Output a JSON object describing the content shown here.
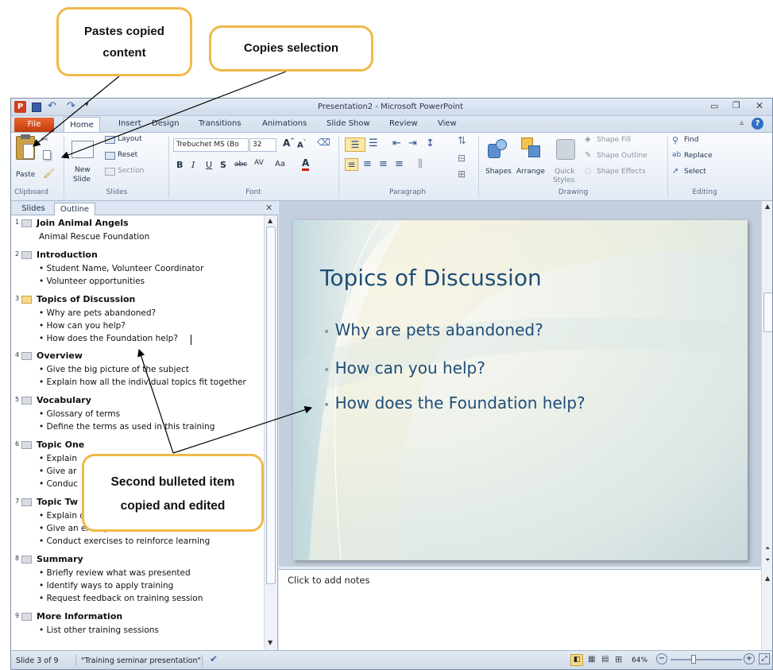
{
  "window": {
    "title": "Presentation2 - Microsoft PowerPoint",
    "tabs": [
      "File",
      "Home",
      "Insert",
      "Design",
      "Transitions",
      "Animations",
      "Slide Show",
      "Review",
      "View"
    ]
  },
  "ribbon": {
    "clipboard": {
      "paste": "Paste",
      "label": "Clipboard"
    },
    "slides": {
      "new_slide": "New",
      "new_slide2": "Slide",
      "layout": "Layout",
      "reset": "Reset",
      "section": "Section",
      "label": "Slides"
    },
    "font": {
      "name": "Trebuchet MS (Bo",
      "size": "32",
      "label": "Font"
    },
    "paragraph": {
      "label": "Paragraph"
    },
    "drawing": {
      "shapes": "Shapes",
      "arrange": "Arrange",
      "quick": "Quick",
      "styles": "Styles",
      "fill": "Shape Fill",
      "outline": "Shape Outline",
      "effects": "Shape Effects",
      "label": "Drawing"
    },
    "editing": {
      "find": "Find",
      "replace": "Replace",
      "select": "Select",
      "label": "Editing"
    }
  },
  "pane": {
    "tab_slides": "Slides",
    "tab_outline": "Outline"
  },
  "outline": [
    {
      "num": "1",
      "title": "Join Animal Angels",
      "lines": [
        "Animal Rescue Foundation"
      ],
      "sub": true
    },
    {
      "num": "2",
      "title": "Introduction",
      "lines": [
        "• Student Name, Volunteer Coordinator",
        "• Volunteer opportunities"
      ]
    },
    {
      "num": "3",
      "title": "Topics of Discussion",
      "lines": [
        "• Why are pets abandoned?",
        "• How can you help?",
        "• How does the Foundation help?"
      ],
      "selected": true
    },
    {
      "num": "4",
      "title": "Overview",
      "lines": [
        "• Give the big picture of the subject",
        "• Explain how all the individual topics fit together"
      ]
    },
    {
      "num": "5",
      "title": "Vocabulary",
      "lines": [
        "• Glossary of terms",
        "• Define the terms as used in this training"
      ]
    },
    {
      "num": "6",
      "title": "Topic One",
      "lines": [
        "• Explain",
        "• Give ar",
        "• Conduc"
      ]
    },
    {
      "num": "7",
      "title": "Topic Tw",
      "lines": [
        "• Explain details",
        "• Give an example",
        "• Conduct exercises to reinforce learning"
      ]
    },
    {
      "num": "8",
      "title": "Summary",
      "lines": [
        "• Briefly review what was presented",
        "• Identify ways to apply training",
        "• Request feedback on training session"
      ]
    },
    {
      "num": "9",
      "title": "More Information",
      "lines": [
        "• List other training sessions"
      ]
    }
  ],
  "slide": {
    "title": "Topics of Discussion",
    "bullets": [
      "Why are pets abandoned?",
      "How can you help?",
      "How does the Foundation help?"
    ]
  },
  "notes_placeholder": "Click to add notes",
  "status": {
    "slide_pos": "Slide 3 of 9",
    "theme": "\"Training seminar presentation\"",
    "zoom": "64%"
  },
  "callouts": {
    "paste": [
      "Pastes copied",
      "content"
    ],
    "copy": "Copies selection",
    "second": [
      "Second bulleted item",
      "copied and edited"
    ]
  },
  "colors": {
    "callout_border": "#f0b94a",
    "slide_title": "#1f4e78",
    "file_tab": "#d44f1c"
  }
}
